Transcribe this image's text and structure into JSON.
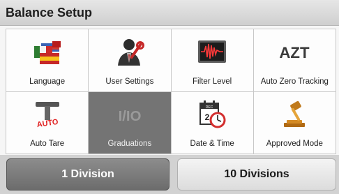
{
  "header": {
    "title": "Balance Setup"
  },
  "menu": {
    "tiles": [
      {
        "label": "Language",
        "icon": "flags-icon"
      },
      {
        "label": "User Settings",
        "icon": "user-settings-icon"
      },
      {
        "label": "Filter Level",
        "icon": "filter-level-icon"
      },
      {
        "label": "Auto Zero Tracking",
        "icon": "azt-icon",
        "icon_text": "AZT"
      },
      {
        "label": "Auto Tare",
        "icon": "auto-tare-icon",
        "icon_text": "AUTO"
      },
      {
        "label": "Graduations",
        "icon": "graduations-icon",
        "icon_text": "I/IO",
        "selected": true
      },
      {
        "label": "Date & Time",
        "icon": "calendar-clock-icon",
        "icon_text": "DEC",
        "icon_day": "2"
      },
      {
        "label": "Approved Mode",
        "icon": "gavel-icon"
      }
    ]
  },
  "options": {
    "one_division": "1 Division",
    "ten_divisions": "10 Divisions"
  },
  "colors": {
    "selected_tile": "#747474",
    "active_button": "#7a7a7a",
    "header": "#d9d9d9"
  }
}
